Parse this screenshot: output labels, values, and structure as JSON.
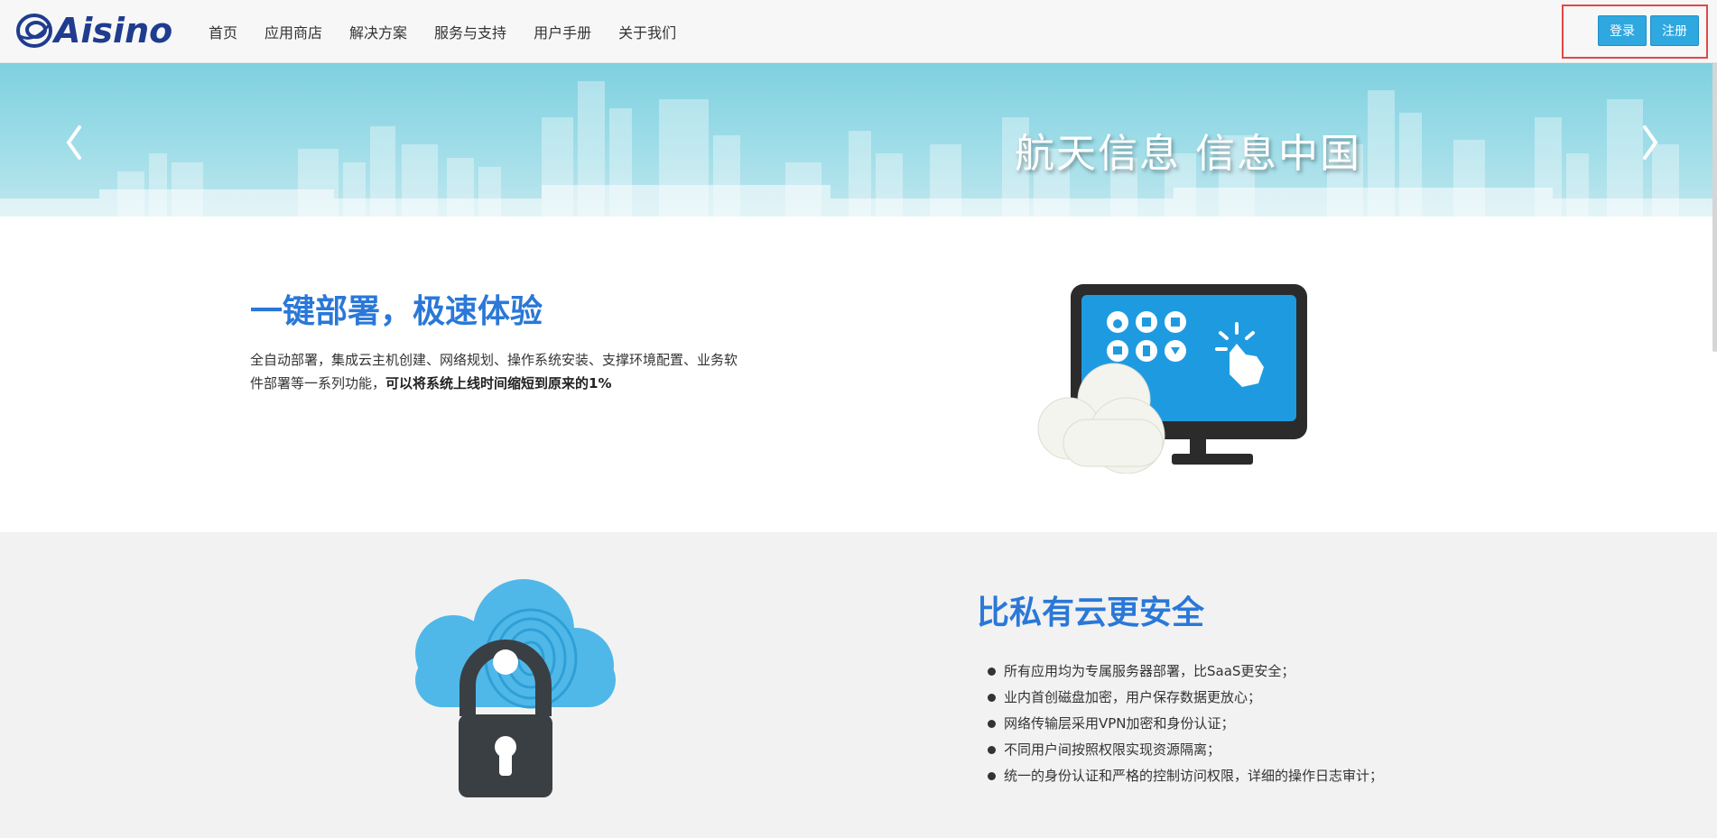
{
  "brand": {
    "name": "Aisino"
  },
  "nav": {
    "items": [
      {
        "label": "首页"
      },
      {
        "label": "应用商店"
      },
      {
        "label": "解决方案"
      },
      {
        "label": "服务与支持"
      },
      {
        "label": "用户手册"
      },
      {
        "label": "关于我们"
      }
    ]
  },
  "auth": {
    "login_label": "登录",
    "register_label": "注册"
  },
  "banner": {
    "slogan": "航天信息 信息中国",
    "prev_icon": "chevron-left-icon",
    "next_icon": "chevron-right-icon"
  },
  "feature1": {
    "title": "一键部署，极速体验",
    "desc_normal": "全自动部署，集成云主机创建、网络规划、操作系统安装、支撑环境配置、业务软件部署等一系列功能，",
    "desc_bold": "可以将系统上线时间缩短到原来的1%"
  },
  "feature2": {
    "title": "比私有云更安全",
    "points": [
      "所有应用均为专属服务器部署，比SaaS更安全；",
      "业内首创磁盘加密，用户保存数据更放心；",
      "网络传输层采用VPN加密和身份认证；",
      "不同用户间按照权限实现资源隔离；",
      " 统一的身份认证和严格的控制访问权限，详细的操作日志审计；"
    ]
  },
  "colors": {
    "accent": "#2a78d8",
    "button": "#2fa7df",
    "highlight_border": "#e04848",
    "banner": "#9fdde8",
    "section_gray": "#f2f2f2"
  }
}
